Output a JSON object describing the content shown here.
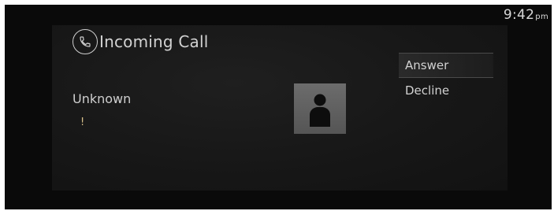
{
  "status_bar": {
    "time": "9:42",
    "ampm": "pm"
  },
  "call_screen": {
    "title": "Incoming Call",
    "title_icon": "phone-icon",
    "caller_name": "Unknown",
    "caller_detail": "!",
    "avatar_icon": "person-icon"
  },
  "options": [
    {
      "label": "Answer",
      "selected": true
    },
    {
      "label": "Decline",
      "selected": false
    }
  ],
  "colors": {
    "screen_background": "#0a0a0a",
    "panel_background": "#1a1a1a",
    "text": "#d2d2d2",
    "caller_detail": "#d8c08a"
  }
}
